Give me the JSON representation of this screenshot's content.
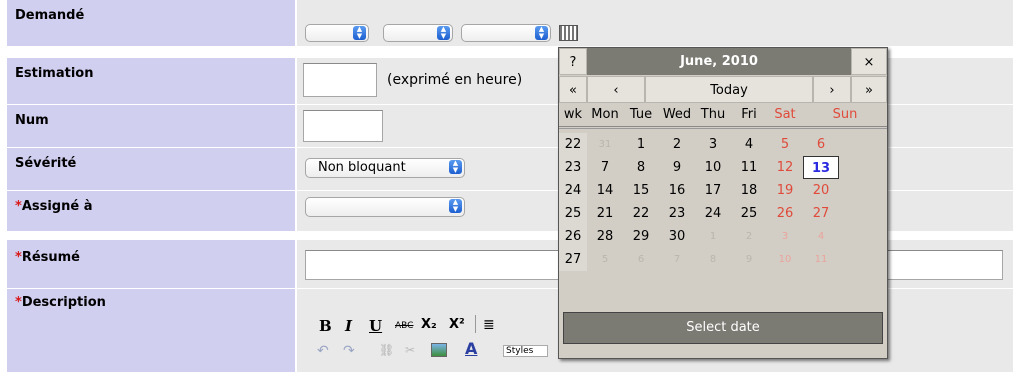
{
  "form": {
    "rows": [
      {
        "label": "Demandé",
        "required": false
      },
      {
        "label": "Estimation",
        "required": false,
        "hint": "(exprimé en heure)"
      },
      {
        "label": "Num",
        "required": false
      },
      {
        "label": "Sévérité",
        "required": false,
        "value": "Non bloquant"
      },
      {
        "label": "Assigné à",
        "required": true,
        "value": ""
      },
      {
        "label": "Résumé",
        "required": true
      },
      {
        "label": "Description",
        "required": true
      }
    ],
    "required_marker": "*"
  },
  "calendar": {
    "help": "?",
    "title": "June, 2010",
    "close": "×",
    "prev_year": "«",
    "prev_month": "‹",
    "today": "Today",
    "next_month": "›",
    "next_year": "»",
    "weekday_headers": [
      "wk",
      "Mon",
      "Tue",
      "Wed",
      "Thu",
      "Fri",
      "Sat",
      "Sun"
    ],
    "weeks": [
      {
        "wk": "22",
        "days": [
          "31",
          "1",
          "2",
          "3",
          "4",
          "5",
          "6"
        ]
      },
      {
        "wk": "23",
        "days": [
          "7",
          "8",
          "9",
          "10",
          "11",
          "12",
          "13"
        ]
      },
      {
        "wk": "24",
        "days": [
          "14",
          "15",
          "16",
          "17",
          "18",
          "19",
          "20"
        ]
      },
      {
        "wk": "25",
        "days": [
          "21",
          "22",
          "23",
          "24",
          "25",
          "26",
          "27"
        ]
      },
      {
        "wk": "26",
        "days": [
          "28",
          "29",
          "30",
          "1",
          "2",
          "3",
          "4"
        ]
      },
      {
        "wk": "27",
        "days": [
          "5",
          "6",
          "7",
          "8",
          "9",
          "10",
          "11"
        ]
      }
    ],
    "selected_day": "13",
    "footer": "Select date"
  },
  "editor": {
    "bold": "B",
    "italic": "I",
    "underline": "U",
    "strike": "ABC",
    "subscript": "X₂",
    "superscript": "X²",
    "styles_label": "Styles"
  },
  "colors": {
    "label_bg": "#d1cfef",
    "required": "#d81a1a",
    "accent": "#2a2ae0"
  }
}
